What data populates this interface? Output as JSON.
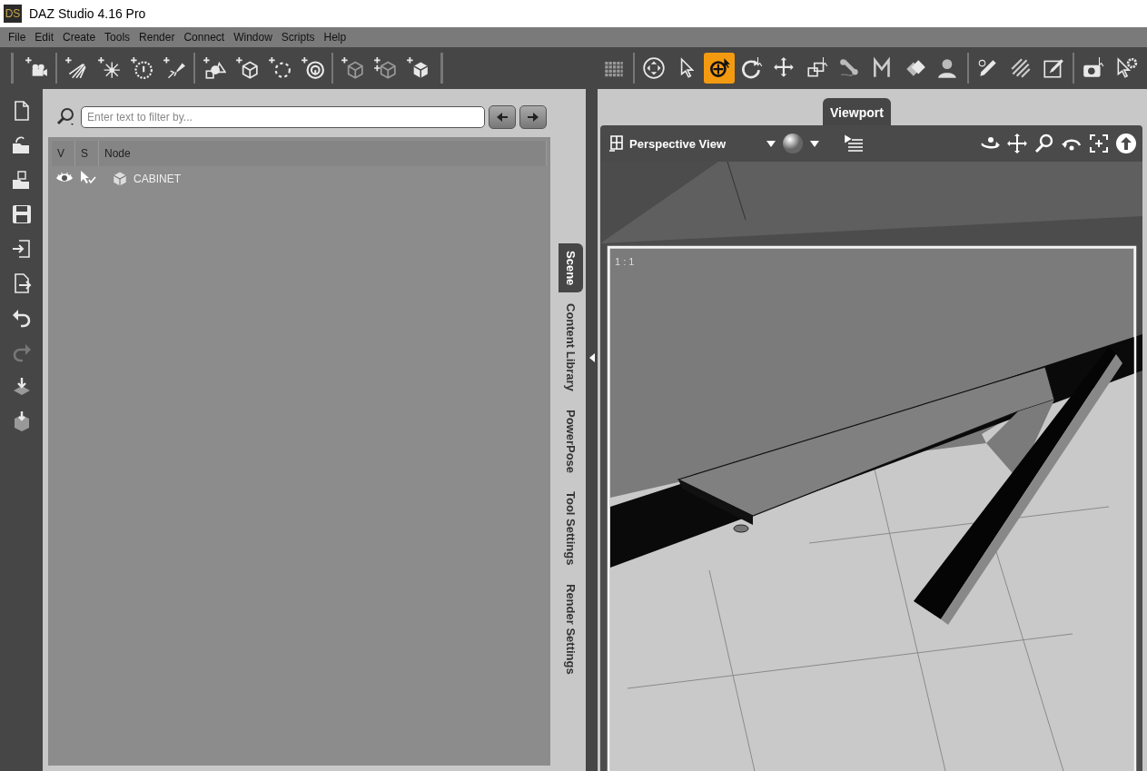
{
  "window": {
    "title": "DAZ Studio 4.16 Pro",
    "logo": "DS"
  },
  "menu_bar": [
    "File",
    "Edit",
    "Create",
    "Tools",
    "Render",
    "Connect",
    "Window",
    "Scripts",
    "Help"
  ],
  "main_toolbar": {
    "create_tools": [
      {
        "kind": "camera",
        "selected": false
      },
      {
        "kind": "rays",
        "selected": false
      },
      {
        "kind": "burst",
        "selected": false
      },
      {
        "kind": "dial",
        "selected": false
      },
      {
        "kind": "flashlight",
        "selected": false
      },
      {
        "kind": "shapes",
        "selected": false
      },
      {
        "kind": "cube",
        "selected": false
      },
      {
        "kind": "dotted-circle",
        "selected": false
      },
      {
        "kind": "ring",
        "selected": false
      },
      {
        "kind": "dim-cube",
        "selected": false
      },
      {
        "kind": "double-cube",
        "selected": false
      },
      {
        "kind": "solid-cube",
        "selected": false
      }
    ],
    "view_tools": [
      {
        "kind": "grid",
        "selected": false
      },
      {
        "kind": "circle-arrows",
        "selected": false
      },
      {
        "kind": "cursor",
        "selected": false
      },
      {
        "kind": "move-circle",
        "selected": true
      },
      {
        "kind": "rotate",
        "selected": false
      },
      {
        "kind": "move",
        "selected": false
      },
      {
        "kind": "scale",
        "selected": false
      },
      {
        "kind": "bone",
        "selected": false
      },
      {
        "kind": "letter",
        "selected": false
      },
      {
        "kind": "layers",
        "selected": false
      },
      {
        "kind": "person",
        "selected": false
      },
      {
        "kind": "pencil",
        "selected": false
      },
      {
        "kind": "brush",
        "selected": false
      },
      {
        "kind": "edit",
        "selected": false
      },
      {
        "kind": "camera-cursor",
        "selected": false
      },
      {
        "kind": "cursor-gear",
        "selected": false
      }
    ]
  },
  "side_toolbar": [
    {
      "kind": "new-file",
      "disabled": false
    },
    {
      "kind": "open-folder",
      "disabled": false
    },
    {
      "kind": "merge-folder",
      "disabled": false
    },
    {
      "kind": "save",
      "disabled": false
    },
    {
      "kind": "import",
      "disabled": false
    },
    {
      "kind": "export",
      "disabled": false
    },
    {
      "kind": "undo",
      "disabled": false
    },
    {
      "kind": "redo",
      "disabled": true
    },
    {
      "kind": "load",
      "disabled": false
    },
    {
      "kind": "load-figure",
      "disabled": false
    }
  ],
  "scene_pane": {
    "filter": {
      "placeholder": "Enter text to filter by..."
    },
    "columns": [
      "V",
      "S",
      "Node"
    ],
    "rows": [
      {
        "visible": true,
        "selectable": true,
        "name": "CABINET"
      }
    ]
  },
  "pane_tabs": [
    {
      "label": "Scene",
      "selected": true
    },
    {
      "label": "Content Library",
      "selected": false
    },
    {
      "label": "PowerPose",
      "selected": false
    },
    {
      "label": "Tool Settings",
      "selected": false
    },
    {
      "label": "Render Settings",
      "selected": false
    }
  ],
  "viewport": {
    "tabs": [
      {
        "label": "Viewport",
        "selected": true
      }
    ],
    "view_menu": "Perspective View",
    "aspect_label": "1 : 1"
  }
}
